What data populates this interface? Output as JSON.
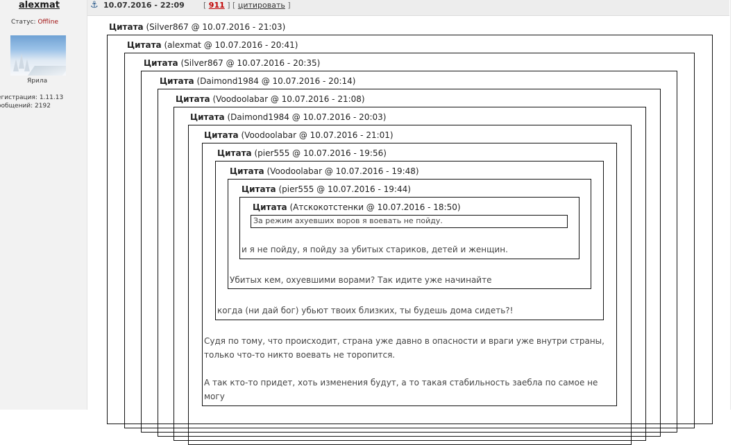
{
  "user": {
    "name": "alexmat",
    "status_label": "Статус:",
    "status_value": "Offline",
    "avatar_caption": "Ярила",
    "registration": "егистрация: 1.11.13",
    "posts": "ообщений: 2192"
  },
  "post": {
    "datetime": "10.07.2016 - 22:09",
    "number": "911",
    "quote_label": "цитировать",
    "bracket_open": "[",
    "bracket_mid": "] [",
    "bracket_close": "]"
  },
  "quotes": [
    {
      "label": "Цитата",
      "meta": "(Silver867 @ 10.07.2016 - 21:03)"
    },
    {
      "label": "Цитата",
      "meta": "(alexmat @ 10.07.2016 - 20:41)"
    },
    {
      "label": "Цитата",
      "meta": "(Silver867 @ 10.07.2016 - 20:35)"
    },
    {
      "label": "Цитата",
      "meta": "(Daimond1984 @ 10.07.2016 - 20:14)"
    },
    {
      "label": "Цитата",
      "meta": "(Voodoolabar @ 10.07.2016 - 21:08)"
    },
    {
      "label": "Цитата",
      "meta": "(Daimond1984 @ 10.07.2016 - 20:03)"
    },
    {
      "label": "Цитата",
      "meta": "(Voodoolabar @ 10.07.2016 - 21:01)"
    },
    {
      "label": "Цитата",
      "meta": "(pier555 @ 10.07.2016 - 19:56)"
    },
    {
      "label": "Цитата",
      "meta": "(Voodoolabar @ 10.07.2016 - 19:48)"
    },
    {
      "label": "Цитата",
      "meta": "(pier555 @ 10.07.2016 - 19:44)"
    },
    {
      "label": "Цитата",
      "meta": "(Атскокотстенки @ 10.07.2016 - 18:50)"
    }
  ],
  "texts": {
    "innermost": "За режим ахуевших воров я воевать не пойду.",
    "t10": "и я не пойду, я пойду за убитых стариков, детей и женщин.",
    "t9": "Убитых кем, охуевшими ворами? Так идите уже начинайте",
    "t8": "когда (ни дай бог) убьют твоих близких, ты будешь дома сидеть?!",
    "t7a": "Судя по тому, что происходит, страна уже давно в опасности и враги уже внутри страны, только что-то никто воевать не торопится.",
    "t7b": "А так кто-то придет, хоть изменения будут, а то такая стабильность заебла по самое не могу"
  }
}
